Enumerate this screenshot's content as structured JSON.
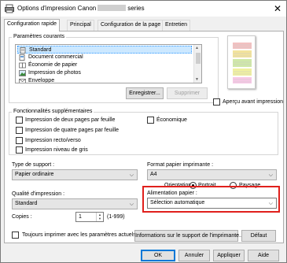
{
  "window": {
    "title_prefix": "Options d'impression Canon",
    "title_suffix": "series",
    "close_glyph": "✕"
  },
  "tabs": [
    {
      "label": "Configuration rapide"
    },
    {
      "label": "Principal"
    },
    {
      "label": "Configuration de la page"
    },
    {
      "label": "Entretien"
    }
  ],
  "settings": {
    "group_label": "Paramètres courants",
    "items": [
      {
        "label": "Standard"
      },
      {
        "label": "Document commercial"
      },
      {
        "label": "Économie de papier"
      },
      {
        "label": "Impression de photos"
      },
      {
        "label": "Enveloppe"
      }
    ],
    "save_button": "Enregistrer...",
    "delete_button": "Supprimer",
    "preview_label": "Aperçu avant impression"
  },
  "features": {
    "group_label": "Fonctionnalités supplémentaires",
    "options": [
      {
        "label": "Impression de deux pages par feuille"
      },
      {
        "label": "Impression de quatre pages par feuille"
      },
      {
        "label": "Impression recto/verso"
      },
      {
        "label": "Impression niveau de gris"
      },
      {
        "label": "Économique"
      }
    ]
  },
  "media": {
    "support_label": "Type de support :",
    "support_value": "Papier ordinaire",
    "format_label": "Format papier imprimante :",
    "format_value": "A4",
    "orientation_label": "Orientation :",
    "portrait": "Portrait",
    "landscape": "Paysage",
    "quality_label": "Qualité d'impression :",
    "quality_value": "Standard",
    "source_label": "Alimentation papier :",
    "source_value": "Sélection automatique",
    "copies_label": "Copies :",
    "copies_value": "1",
    "copies_range": "(1-999)"
  },
  "footer": {
    "always_label": "Toujours imprimer avec les paramètres actuels",
    "info_button": "Informations sur le support de l'imprimante...",
    "default_button": "Défaut",
    "ok": "OK",
    "cancel": "Annuler",
    "apply": "Appliquer",
    "help": "Aide"
  },
  "colors": {
    "highlight": "#e0201c",
    "accent": "#0078d7"
  }
}
